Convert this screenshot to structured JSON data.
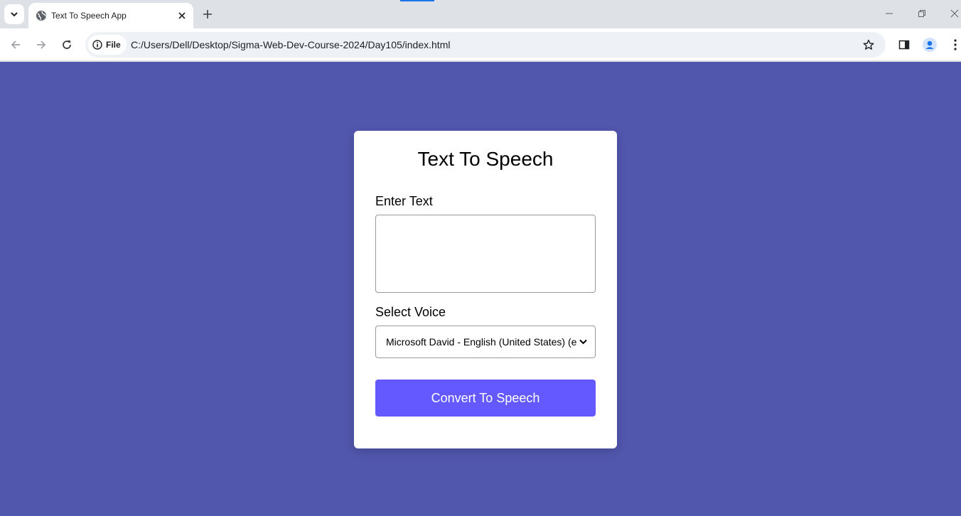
{
  "browser": {
    "tab": {
      "title": "Text To Speech App",
      "favicon": "globe-icon"
    },
    "address_bar": {
      "chip_label": "File",
      "url": "C:/Users/Dell/Desktop/Sigma-Web-Dev-Course-2024/Day105/index.html"
    },
    "icons": [
      "tab-search-icon",
      "globe-icon",
      "close-icon",
      "plus-icon",
      "minimize-icon",
      "restore-icon",
      "window-close-icon",
      "back-arrow-icon",
      "forward-arrow-icon",
      "reload-icon",
      "info-icon",
      "star-icon",
      "side-panel-icon",
      "profile-icon",
      "more-vert-icon"
    ],
    "accent_color": "#1a73e8"
  },
  "page": {
    "background_color": "#5257ae",
    "card": {
      "title": "Text To Speech",
      "text_label": "Enter Text",
      "text_value": "",
      "voice_label": "Select Voice",
      "voice_selected": "Microsoft David - English (United States) (en-US)",
      "button_label": "Convert To Speech",
      "button_color": "#6459fe"
    }
  }
}
